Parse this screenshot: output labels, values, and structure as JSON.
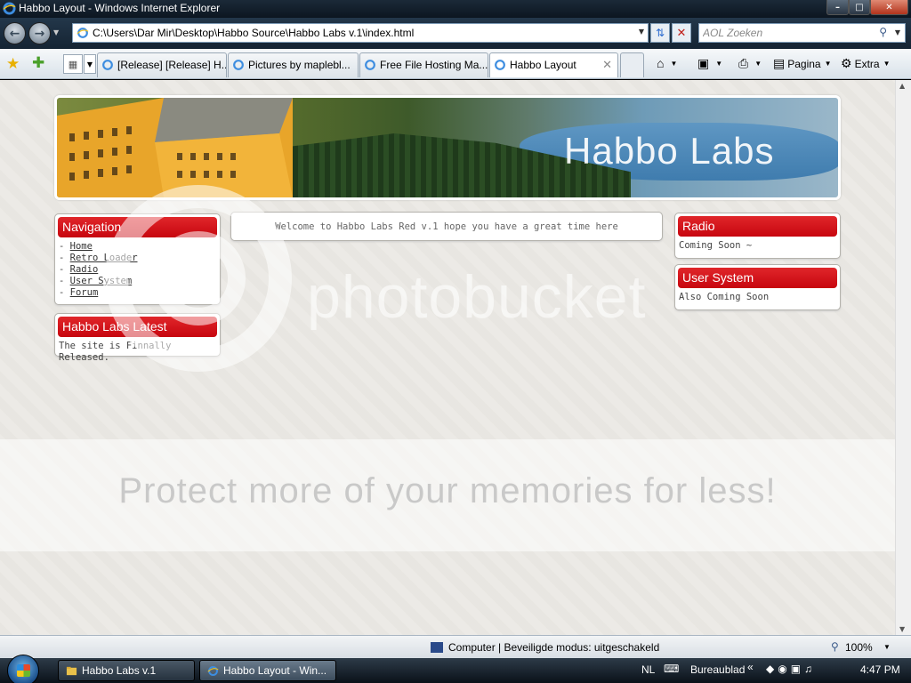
{
  "window": {
    "title": "Habbo Layout - Windows Internet Explorer",
    "minimize": "–",
    "maximize": "□",
    "close": "✕"
  },
  "addressbar": {
    "url": "C:\\Users\\Dar Mir\\Desktop\\Habbo Source\\Habbo Labs v.1\\index.html",
    "search_placeholder": "AOL Zoeken"
  },
  "tabs": [
    {
      "label": "[Release] [Release] H...",
      "active": false
    },
    {
      "label": "Pictures by maplebl...",
      "active": false
    },
    {
      "label": "Free File Hosting Ma...",
      "active": false
    },
    {
      "label": "Habbo Layout",
      "active": true
    }
  ],
  "commandbar": {
    "page_label": "Pagina",
    "tools_label": "Extra"
  },
  "page": {
    "banner_title": "Habbo Labs",
    "welcome_text": "Welcome to Habbo Labs Red v.1 hope you have a great time here",
    "navigation": {
      "title": "Navigation",
      "links": [
        "Home",
        "Retro Loader",
        "Radio",
        "User System",
        "Forum"
      ]
    },
    "latest": {
      "title": "Habbo Labs Latest",
      "text": "The site is Finnally Released."
    },
    "radio": {
      "title": "Radio",
      "text": "Coming Soon ~"
    },
    "user_system": {
      "title": "User System",
      "text": "Also Coming Soon"
    }
  },
  "watermark": {
    "brand": "photobucket",
    "tagline": "Protect more of your memories for less!"
  },
  "statusbar": {
    "zone": "Computer | Beveiligde modus: uitgeschakeld",
    "zoom": "100%"
  },
  "taskbar": {
    "items": [
      {
        "label": "Habbo Labs v.1"
      },
      {
        "label": "Habbo Layout - Win..."
      }
    ],
    "language": "NL",
    "desktop_label": "Bureaublad",
    "clock": "4:47 PM"
  },
  "colors": {
    "box_header": "#c7060f",
    "page_background": "#eceae5",
    "titlebar": "#1b2a38"
  }
}
